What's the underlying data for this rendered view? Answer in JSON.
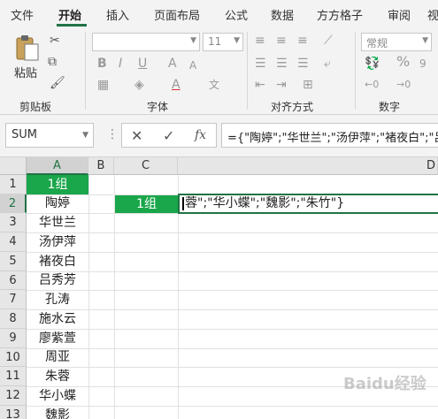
{
  "ribbon_tabs": [
    "文件",
    "开始",
    "插入",
    "页面布局",
    "公式",
    "数据",
    "方方格子",
    "审阅",
    "视"
  ],
  "ribbon": {
    "clipboard": {
      "paste_label": "粘贴",
      "group_label": "剪贴板"
    },
    "font": {
      "font_name": "",
      "font_size": "11",
      "group_label": "字体",
      "bold": "B",
      "italic": "I",
      "underline": "U"
    },
    "alignment": {
      "group_label": "对齐方式"
    },
    "number": {
      "format": "常规",
      "group_label": "数字",
      "percent": "%"
    }
  },
  "formula_bar": {
    "name_box": "SUM",
    "cancel": "✕",
    "confirm": "✓",
    "fx": "fx",
    "formula": "={\"陶婷\";\"华世兰\";\"汤伊萍\";\"褚夜白\";\"吕秀芳\";\"孔涛\";\"施水云\";\"廖紫萱\";\"周亚\";\"朱蓉\";\"华小蝶\";\"魏影\";\"朱竹\"}"
  },
  "columns": [
    "A",
    "B",
    "C",
    "D"
  ],
  "rows": [
    "1",
    "2",
    "3",
    "4",
    "5",
    "6",
    "7",
    "8",
    "9",
    "10",
    "11",
    "12",
    "13"
  ],
  "cells": {
    "A": [
      "1组",
      "陶婷",
      "华世兰",
      "汤伊萍",
      "褚夜白",
      "吕秀芳",
      "孔涛",
      "施水云",
      "廖紫萱",
      "周亚",
      "朱蓉",
      "华小蝶",
      "魏影"
    ],
    "C2": "1组",
    "D2_edit": "蓉\";\"华小蝶\";\"魏影\";\"朱竹\"}"
  },
  "colors": {
    "accent": "#217346",
    "green_fill": "#1aa64a"
  },
  "watermark": "Baidu经验"
}
